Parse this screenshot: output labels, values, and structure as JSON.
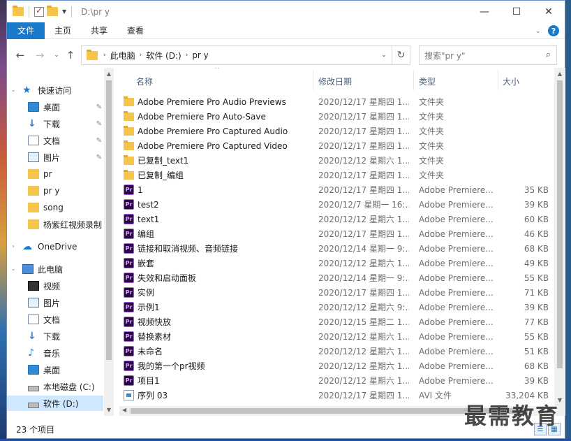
{
  "window": {
    "title": "D:\\pr y",
    "controls": {
      "minimize": "—",
      "maximize": "☐",
      "close": "✕"
    }
  },
  "ribbon": {
    "tabs": [
      "文件",
      "主页",
      "共享",
      "查看"
    ]
  },
  "address": {
    "crumbs": [
      "此电脑",
      "软件 (D:)",
      "pr y"
    ],
    "search_placeholder": "搜索\"pr y\""
  },
  "sidebar": {
    "items": [
      {
        "label": "快速访问",
        "icon": "star-icon"
      },
      {
        "label": "桌面",
        "icon": "desktop-icon",
        "pinned": true
      },
      {
        "label": "下载",
        "icon": "download-icon",
        "pinned": true
      },
      {
        "label": "文档",
        "icon": "document-icon",
        "pinned": true
      },
      {
        "label": "图片",
        "icon": "pictures-icon",
        "pinned": true
      },
      {
        "label": "pr",
        "icon": "folder-icon"
      },
      {
        "label": "pr y",
        "icon": "folder-icon"
      },
      {
        "label": "song",
        "icon": "folder-icon"
      },
      {
        "label": "杨紫红视频录制",
        "icon": "folder-icon"
      },
      {
        "label": "OneDrive",
        "icon": "onedrive-icon"
      },
      {
        "label": "此电脑",
        "icon": "this-pc-icon"
      },
      {
        "label": "视频",
        "icon": "videos-icon"
      },
      {
        "label": "图片",
        "icon": "pictures-icon"
      },
      {
        "label": "文档",
        "icon": "document-icon"
      },
      {
        "label": "下载",
        "icon": "download-icon"
      },
      {
        "label": "音乐",
        "icon": "music-icon"
      },
      {
        "label": "桌面",
        "icon": "desktop-icon"
      },
      {
        "label": "本地磁盘 (C:)",
        "icon": "drive-icon"
      },
      {
        "label": "软件 (D:)",
        "icon": "drive-icon",
        "selected": true
      }
    ]
  },
  "columns": {
    "name": "名称",
    "date": "修改日期",
    "type": "类型",
    "size": "大小"
  },
  "files": [
    {
      "name": "Adobe Premiere Pro Audio Previews",
      "date": "2020/12/17 星期四 1...",
      "type": "文件夹",
      "size": "",
      "kind": "folder"
    },
    {
      "name": "Adobe Premiere Pro Auto-Save",
      "date": "2020/12/17 星期四 1...",
      "type": "文件夹",
      "size": "",
      "kind": "folder"
    },
    {
      "name": "Adobe Premiere Pro Captured Audio",
      "date": "2020/12/17 星期四 1...",
      "type": "文件夹",
      "size": "",
      "kind": "folder"
    },
    {
      "name": "Adobe Premiere Pro Captured Video",
      "date": "2020/12/17 星期四 1...",
      "type": "文件夹",
      "size": "",
      "kind": "folder"
    },
    {
      "name": "已复制_text1",
      "date": "2020/12/12 星期六 1...",
      "type": "文件夹",
      "size": "",
      "kind": "folder"
    },
    {
      "name": "已复制_编组",
      "date": "2020/12/17 星期四 1...",
      "type": "文件夹",
      "size": "",
      "kind": "folder"
    },
    {
      "name": "1",
      "date": "2020/12/17 星期四 1...",
      "type": "Adobe Premiere...",
      "size": "35 KB",
      "kind": "pr"
    },
    {
      "name": "test2",
      "date": "2020/12/7 星期一 16:...",
      "type": "Adobe Premiere...",
      "size": "39 KB",
      "kind": "pr"
    },
    {
      "name": "text1",
      "date": "2020/12/12 星期六 1...",
      "type": "Adobe Premiere...",
      "size": "60 KB",
      "kind": "pr"
    },
    {
      "name": "编组",
      "date": "2020/12/17 星期四 1...",
      "type": "Adobe Premiere...",
      "size": "46 KB",
      "kind": "pr"
    },
    {
      "name": "链接和取消视频、音频链接",
      "date": "2020/12/14 星期一 9:...",
      "type": "Adobe Premiere...",
      "size": "68 KB",
      "kind": "pr"
    },
    {
      "name": "嵌套",
      "date": "2020/12/12 星期六 1...",
      "type": "Adobe Premiere...",
      "size": "49 KB",
      "kind": "pr"
    },
    {
      "name": "失效和启动面板",
      "date": "2020/12/14 星期一 9:...",
      "type": "Adobe Premiere...",
      "size": "55 KB",
      "kind": "pr"
    },
    {
      "name": "实例",
      "date": "2020/12/17 星期四 1...",
      "type": "Adobe Premiere...",
      "size": "71 KB",
      "kind": "pr"
    },
    {
      "name": "示例1",
      "date": "2020/12/12 星期六 9:...",
      "type": "Adobe Premiere...",
      "size": "39 KB",
      "kind": "pr"
    },
    {
      "name": "视频快放",
      "date": "2020/12/15 星期二 1...",
      "type": "Adobe Premiere...",
      "size": "77 KB",
      "kind": "pr"
    },
    {
      "name": "替换素材",
      "date": "2020/12/12 星期六 1...",
      "type": "Adobe Premiere...",
      "size": "55 KB",
      "kind": "pr"
    },
    {
      "name": "未命名",
      "date": "2020/12/12 星期六 1...",
      "type": "Adobe Premiere...",
      "size": "51 KB",
      "kind": "pr"
    },
    {
      "name": "我的第一个pr视频",
      "date": "2020/12/12 星期六 1...",
      "type": "Adobe Premiere...",
      "size": "68 KB",
      "kind": "pr"
    },
    {
      "name": "项目1",
      "date": "2020/12/12 星期六 1...",
      "type": "Adobe Premiere...",
      "size": "39 KB",
      "kind": "pr"
    },
    {
      "name": "序列 03",
      "date": "2020/12/17 星期四 1...",
      "type": "AVI 文件",
      "size": "33,204 KB",
      "kind": "avi"
    }
  ],
  "status": {
    "count": "23 个项目"
  },
  "watermark": "最需教育",
  "colors": {
    "accent": "#1979ca",
    "selection": "#cde8ff",
    "folder": "#f4c54a"
  }
}
